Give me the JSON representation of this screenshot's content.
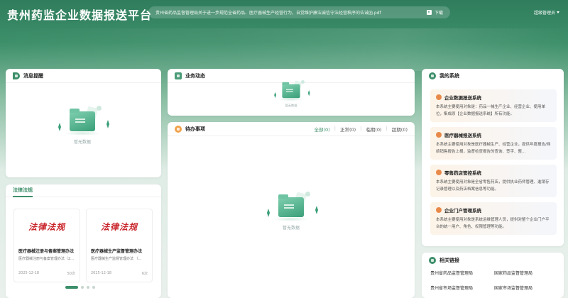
{
  "header": {
    "title": "贵州药监企业数据报送平台",
    "notice": "贵州省药品监督管理局关于进一步规范全省药品、医疗器械生产经营行为，自觉维护廉洁诚信守法经营秩序的告诫函.pdf",
    "download_label": "下载",
    "user": "超级管理员"
  },
  "messages": {
    "title": "消息提醒",
    "empty": "暂无数据"
  },
  "business": {
    "title": "业务动态",
    "empty": "暂无数据"
  },
  "todo": {
    "title": "待办事项",
    "filters": [
      {
        "label": "全部(0)"
      },
      {
        "label": "正常(0)"
      },
      {
        "label": "临期(0)"
      },
      {
        "label": "超期(0)"
      }
    ],
    "empty": "暂无数据"
  },
  "laws": {
    "tab": "法律法规",
    "cards": [
      {
        "banner": "法律法规",
        "title": "医疗器械注册与备案管理办法",
        "subtitle": "医疗器械注册与备案管理办法（2...",
        "date": "2025-12-18",
        "views": "50次"
      },
      {
        "banner": "法律法规",
        "title": "医疗器械生产监督管理办法",
        "subtitle": "医疗器械生产监督管理办法  （...",
        "date": "2025-12-18",
        "views": "6次"
      }
    ]
  },
  "systems": {
    "title": "我的系统",
    "items": [
      {
        "title": "企业数据报送系统",
        "desc": "本系统主要使用对象是：药品一械生产企业、经营企业、使用单位，集成原【企业数据报送系统】所有功能。"
      },
      {
        "title": "医疗器械报送系统",
        "desc": "本系统主要使用对象是医疗器械生产、经营企业，提供年度报告/网络销售报告上报，监督检查报告的查询、签字、整..."
      },
      {
        "title": "零售药店管控系统",
        "desc": "本系统主要使用对象是全省零售药店，提供执业药师管理、進销存记录管理以及药店档案信息等功能。"
      },
      {
        "title": "企业门户管理系统",
        "desc": "本系统主要使用对象是系统运维管理人员，提供对整个企业门户平台的统一用户、角色、权限管理等功能。"
      }
    ]
  },
  "related": {
    "title": "相关链接",
    "links": [
      {
        "label": "贵州省药品监督管理局"
      },
      {
        "label": "国家药品监督管理局"
      },
      {
        "label": "贵州省市场监督管理局"
      },
      {
        "label": "国家市场监督管理局"
      }
    ]
  },
  "colors": {
    "brand": "#3d8f6a",
    "accent": "#e8894a",
    "law_red": "#c9252b"
  }
}
